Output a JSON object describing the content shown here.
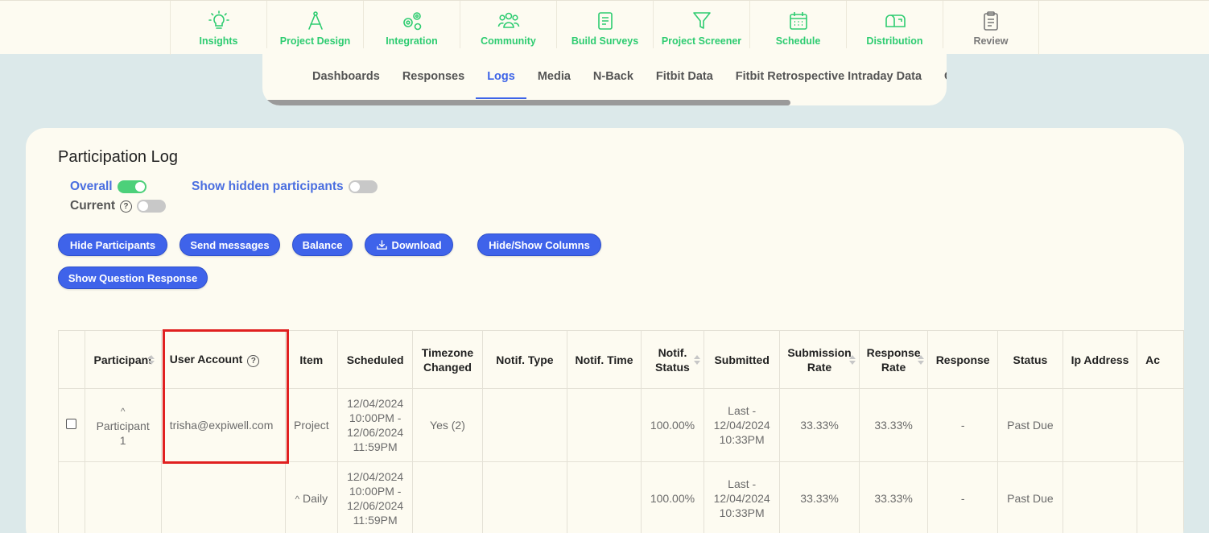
{
  "nav": {
    "items": [
      {
        "label": "Insights",
        "icon": "lightbulb-icon"
      },
      {
        "label": "Project Design",
        "icon": "compass-icon"
      },
      {
        "label": "Integration",
        "icon": "gears-icon"
      },
      {
        "label": "Community",
        "icon": "people-icon"
      },
      {
        "label": "Build Surveys",
        "icon": "survey-icon"
      },
      {
        "label": "Project Screener",
        "icon": "filter-icon"
      },
      {
        "label": "Schedule",
        "icon": "calendar-icon"
      },
      {
        "label": "Distribution",
        "icon": "mailbox-icon"
      },
      {
        "label": "Review",
        "icon": "clipboard-icon"
      }
    ],
    "accent": "#2ecc71"
  },
  "subtabs": [
    "Dashboards",
    "Responses",
    "Logs",
    "Media",
    "N-Back",
    "Fitbit Data",
    "Fitbit Retrospective Intraday Data",
    "C"
  ],
  "active_subtab": "Logs",
  "page": {
    "title": "Participation Log",
    "toggles": {
      "overall": "Overall",
      "current": "Current",
      "hidden": "Show hidden participants"
    },
    "buttons": {
      "hide_participants": "Hide Participants",
      "send_messages": "Send messages",
      "balance": "Balance",
      "download": "Download",
      "hide_show_columns": "Hide/Show Columns",
      "show_question_response": "Show Question Response"
    }
  },
  "table": {
    "headers": {
      "participant": "Participant",
      "user_account": "User Account",
      "item": "Item",
      "scheduled": "Scheduled",
      "timezone_1": "Timezone",
      "timezone_2": "Changed",
      "notif_type": "Notif. Type",
      "notif_time": "Notif. Time",
      "notif_status_1": "Notif.",
      "notif_status_2": "Status",
      "submitted": "Submitted",
      "submission_rate_1": "Submission",
      "submission_rate_2": "Rate",
      "response_rate_1": "Response",
      "response_rate_2": "Rate",
      "response": "Response",
      "status": "Status",
      "ip_address": "Ip Address",
      "ac": "Ac"
    },
    "rows": [
      {
        "participant_1": "Participant",
        "participant_2": "1",
        "user_account": "trisha@expiwell.com",
        "item": "Project",
        "sched_1": "12/04/2024",
        "sched_2": "10:00PM -",
        "sched_3": "12/06/2024",
        "sched_4": "11:59PM",
        "timezone_changed": "Yes (2)",
        "notif_status": "100.00%",
        "sub_1": "Last -",
        "sub_2": "12/04/2024",
        "sub_3": "10:33PM",
        "submission_rate": "33.33%",
        "response_rate": "33.33%",
        "response": "-",
        "status": "Past Due"
      },
      {
        "item": "Daily",
        "sched_1": "12/04/2024",
        "sched_2": "10:00PM -",
        "sched_3": "12/06/2024",
        "sched_4": "11:59PM",
        "notif_status": "100.00%",
        "sub_1": "Last -",
        "sub_2": "12/04/2024",
        "sub_3": "10:33PM",
        "submission_rate": "33.33%",
        "response_rate": "33.33%",
        "response": "-",
        "status": "Past Due"
      }
    ]
  }
}
